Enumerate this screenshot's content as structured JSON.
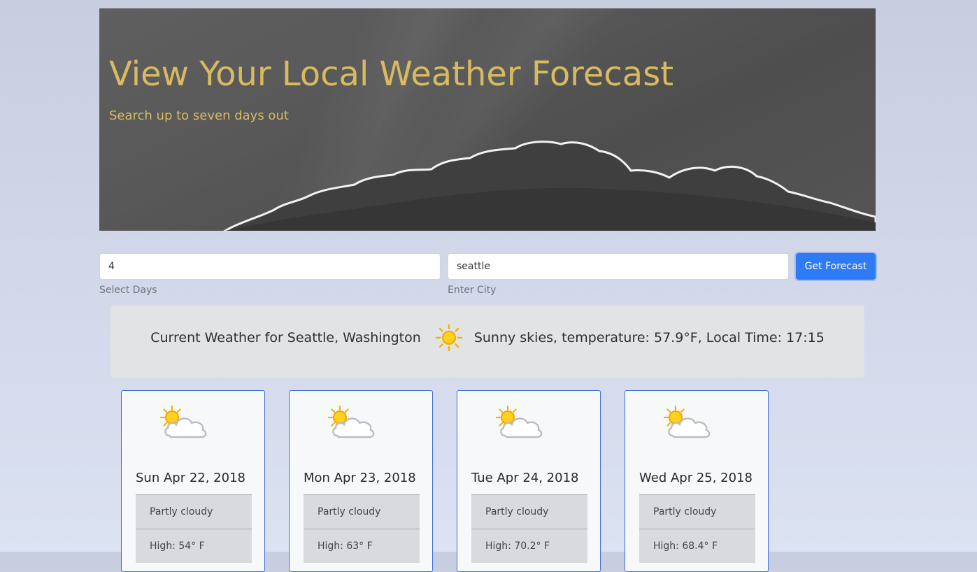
{
  "header": {
    "title": "View Your Local Weather Forecast",
    "subtitle": "Search up to seven days out"
  },
  "form": {
    "days": {
      "value": "4",
      "help": "Select Days"
    },
    "city": {
      "value": "seattle",
      "help": "Enter City"
    },
    "submit_label": "Get Forecast"
  },
  "current": {
    "location_text": "Current Weather for Seattle, Washington",
    "icon": "sun-icon",
    "summary_text": "Sunny skies, temperature: 57.9°F, Local Time: 17:15"
  },
  "forecast": [
    {
      "date": "Sun Apr 22, 2018",
      "icon": "partly-cloudy-icon",
      "condition": "Partly cloudy",
      "high": "High: 54° F"
    },
    {
      "date": "Mon Apr 23, 2018",
      "icon": "partly-cloudy-icon",
      "condition": "Partly cloudy",
      "high": "High: 63° F"
    },
    {
      "date": "Tue Apr 24, 2018",
      "icon": "partly-cloudy-icon",
      "condition": "Partly cloudy",
      "high": "High: 70.2° F"
    },
    {
      "date": "Wed Apr 25, 2018",
      "icon": "partly-cloudy-icon",
      "condition": "Partly cloudy",
      "high": "High: 68.4° F"
    }
  ],
  "colors": {
    "accent": "#2f7bf5",
    "title": "#d8bb60",
    "card_border": "#3b6fd8"
  }
}
